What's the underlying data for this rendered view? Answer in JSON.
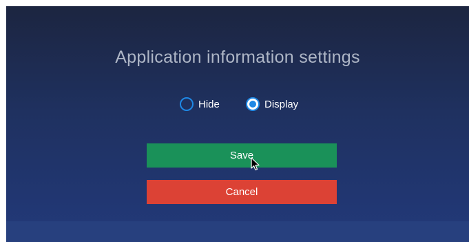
{
  "dialog": {
    "title": "Application information settings"
  },
  "visibility": {
    "options": [
      {
        "label": "Hide",
        "selected": false
      },
      {
        "label": "Display",
        "selected": true
      }
    ]
  },
  "actions": {
    "save_label": "Save",
    "cancel_label": "Cancel"
  },
  "colors": {
    "save": "#1a9159",
    "cancel": "#dc4235",
    "radio_accent": "#1e88e5"
  },
  "icons": {
    "pointer": "mouse-pointer-icon"
  }
}
